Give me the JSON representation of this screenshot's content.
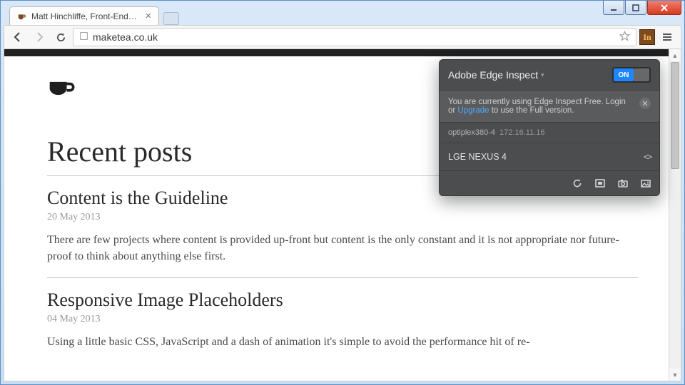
{
  "window": {
    "tab_title": "Matt Hinchliffe, Front-End…"
  },
  "toolbar": {
    "url": "maketea.co.uk",
    "extension_badge": "In"
  },
  "page": {
    "heading": "Recent posts",
    "posts": [
      {
        "title": "Content is the Guideline",
        "date": "20 May 2013",
        "excerpt": "There are few projects where content is provided up-front but content is the only constant and it is not appropriate nor future-proof to think about anything else first."
      },
      {
        "title": "Responsive Image Placeholders",
        "date": "04 May 2013",
        "excerpt": "Using a little basic CSS, JavaScript and a dash of animation it's simple to avoid the performance hit of re-"
      }
    ]
  },
  "popover": {
    "title": "Adobe Edge Inspect",
    "toggle_label": "ON",
    "notice_pre": "You are currently using Edge Inspect Free. Login or ",
    "notice_link": "Upgrade",
    "notice_post": " to use the Full version.",
    "host_name": "optiplex380-4",
    "host_ip": "172.16.11.16",
    "device": "LGE NEXUS 4"
  }
}
